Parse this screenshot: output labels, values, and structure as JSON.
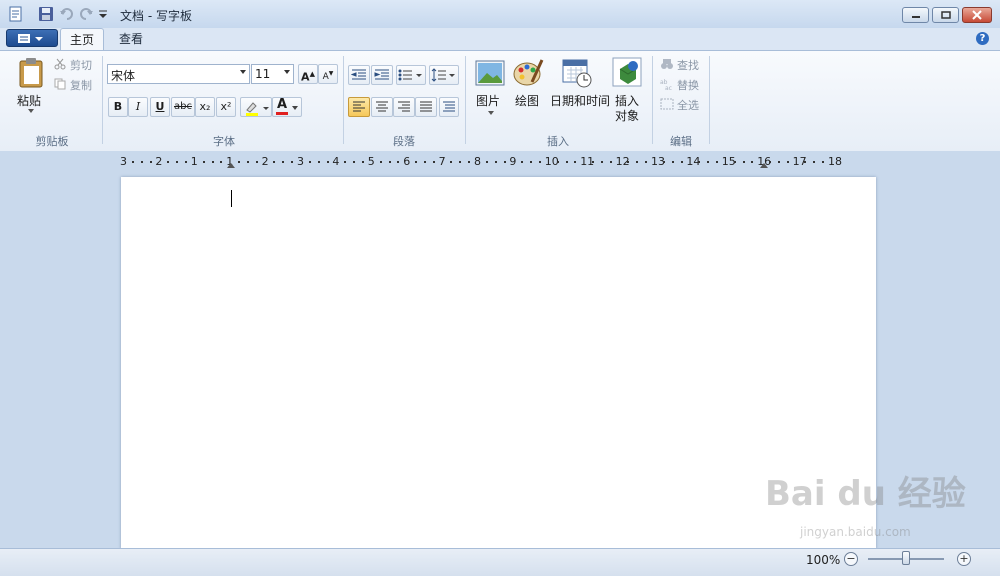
{
  "window": {
    "title": "文档 - 写字板"
  },
  "tabs": [
    {
      "label": "主页"
    },
    {
      "label": "查看"
    }
  ],
  "clipboard": {
    "paste_label": "粘贴",
    "cut_label": "剪切",
    "copy_label": "复制",
    "group_label": "剪贴板"
  },
  "font": {
    "family": "宋体",
    "size": "11",
    "group_label": "字体",
    "grow_label": "A",
    "shrink_label": "A",
    "bold": "B",
    "italic": "I",
    "underline": "U",
    "strike": "abc",
    "sub": "x₂",
    "sup": "x²",
    "color_label": "A"
  },
  "paragraph": {
    "group_label": "段落"
  },
  "insert": {
    "picture_label": "图片",
    "paint_label": "绘图",
    "datetime_label": "日期和时间",
    "object_label_1": "插入",
    "object_label_2": "对象",
    "group_label": "插入"
  },
  "editing": {
    "find_label": "查找",
    "replace_label": "替换",
    "selectall_label": "全选",
    "group_label": "编辑"
  },
  "ruler": {
    "ticks": [
      "3",
      "2",
      "1",
      "1",
      "2",
      "3",
      "4",
      "5",
      "6",
      "7",
      "8",
      "9",
      "10",
      "11",
      "12",
      "13",
      "14",
      "15",
      "16",
      "17",
      "18"
    ]
  },
  "status": {
    "zoom": "100%",
    "zoom_level": 1.0
  },
  "watermark": {
    "text": "Bai du 经验",
    "sub": "jingyan.baidu.com"
  },
  "colors": {
    "font_color": "#e02020",
    "highlight": "#ffff00",
    "accent": "#2f6cc1"
  }
}
